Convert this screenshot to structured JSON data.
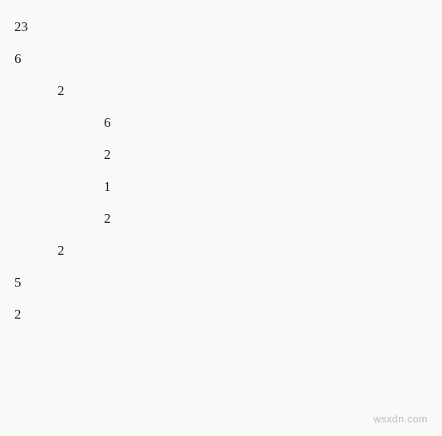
{
  "lines": [
    {
      "value": "23",
      "indent": 0
    },
    {
      "value": "6",
      "indent": 0
    },
    {
      "value": "2",
      "indent": 1
    },
    {
      "value": "6",
      "indent": 2
    },
    {
      "value": "2",
      "indent": 2
    },
    {
      "value": "1",
      "indent": 2
    },
    {
      "value": "2",
      "indent": 2
    },
    {
      "value": "2",
      "indent": 1
    },
    {
      "value": "5",
      "indent": 0
    },
    {
      "value": "2",
      "indent": 0
    }
  ],
  "watermark": "wsxdn.com"
}
